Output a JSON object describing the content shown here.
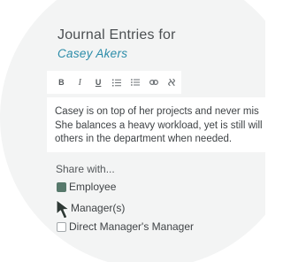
{
  "journal": {
    "title": "Journal Entries for",
    "employee_name": "Casey Akers"
  },
  "toolbar": {
    "bold_label": "B",
    "italic_label": "I",
    "underline_label": "U",
    "buttons": [
      {
        "name": "bold-button",
        "icon": "bold-icon"
      },
      {
        "name": "italic-button",
        "icon": "italic-icon"
      },
      {
        "name": "underline-button",
        "icon": "underline-icon"
      },
      {
        "name": "numbered-list-button",
        "icon": "numbered-list-icon"
      },
      {
        "name": "bulleted-list-button",
        "icon": "bulleted-list-icon"
      },
      {
        "name": "link-button",
        "icon": "link-icon"
      },
      {
        "name": "unlink-button",
        "icon": "unlink-icon"
      }
    ]
  },
  "editor": {
    "lines": [
      "Casey is on top of her projects and never mis",
      "She balances a heavy workload, yet is still will",
      "others in the department when needed."
    ]
  },
  "share": {
    "title": "Share with...",
    "options": [
      {
        "label": "Employee",
        "checked": true
      },
      {
        "label": "Manager(s)",
        "checked": true
      },
      {
        "label": "Direct Manager's Manager",
        "checked": false
      }
    ]
  },
  "colors": {
    "accent_teal": "#2a8ba8",
    "checkbox_green": "#57796c",
    "background_circle": "#f3f4f4",
    "text_dark": "#3f4346"
  },
  "cursor": {
    "icon": "mouse-pointer-icon"
  }
}
